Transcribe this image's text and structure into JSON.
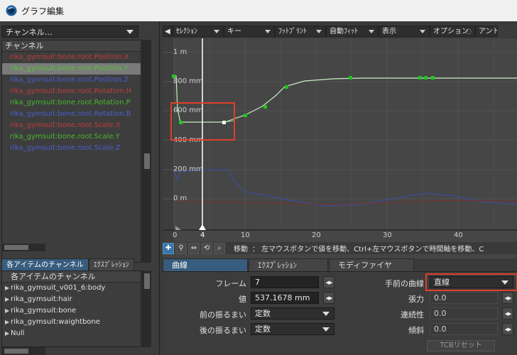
{
  "window": {
    "title": "グラフ編集"
  },
  "left": {
    "channel_dropdown": "チャンネル…",
    "channel_header": "チャンネル",
    "channels": [
      {
        "label": "rika_gymsuit:bone.root.Position.X",
        "color": "#c23b3b"
      },
      {
        "label": "rika_gymsuit:bone.root.Position.Y",
        "color": "#59c23b"
      },
      {
        "label": "rika_gymsuit:bone.root.Position.Z",
        "color": "#4a5fd0"
      },
      {
        "label": "rika_gymsuit:bone.root.Rotation.H",
        "color": "#c23b3b"
      },
      {
        "label": "rika_gymsuit:bone.root.Rotation.P",
        "color": "#45b82e"
      },
      {
        "label": "rika_gymsuit:bone.root.Rotation.B",
        "color": "#4a5fd0"
      },
      {
        "label": "rika_gymsuit:bone.root.Scale.X",
        "color": "#c23b3b"
      },
      {
        "label": "rika_gymsuit:bone.root.Scale.Y",
        "color": "#45b82e"
      },
      {
        "label": "rika_gymsuit:bone.root.Scale.Z",
        "color": "#4a5fd0"
      }
    ],
    "tabs": [
      "各アイテムのチャンネル",
      "ｴｸｽﾌﾟﾚｯｼｮﾝ"
    ],
    "item_header": "各アイテムのチャンネル",
    "items": [
      "rika_gymsuit_v001_6:body",
      "rika_gymsuit:hair",
      "rika_gymsuit:bone",
      "rika_gymsuit:waightbone",
      "Null"
    ]
  },
  "toolbar": {
    "selection": "ｾﾚｸｼｮﾝ",
    "key": "キー",
    "footprint": "ﾌｯﾄﾌﾟﾘﾝﾄ",
    "autofit": "自動ﾌｨｯﾄ",
    "display": "表示",
    "options": "オプション",
    "undo": "アンド"
  },
  "graph": {
    "y_labels": [
      "1 m",
      "800 mm",
      "600 mm",
      "400 mm",
      "200 mm",
      "0 m"
    ],
    "x_labels": [
      "0",
      "4",
      "10",
      "20",
      "30",
      "40"
    ],
    "current_frame": 4
  },
  "tools": {
    "mode_label": "移動",
    "hint": "： 左マウスボタンで値を移動、Ctrl+左マウスボタンで時間軸を移動、C"
  },
  "panel": {
    "tabs": [
      "曲線",
      "ｴｸｽﾌﾟﾚｯｼｮﾝ",
      "モディファイヤ"
    ],
    "frame_label": "フレーム",
    "frame_value": "7",
    "value_label": "値",
    "value_value": "537.1678 mm",
    "pre_behavior_label": "前の振るまい",
    "pre_behavior_value": "定数",
    "post_behavior_label": "後の振るまい",
    "post_behavior_value": "定数",
    "incoming_curve_label": "手前の曲線",
    "incoming_curve_value": "直線",
    "tension_label": "張力",
    "tension_value": "0.0",
    "continuity_label": "連続性",
    "continuity_value": "0.0",
    "bias_label": "傾斜",
    "bias_value": "0.0",
    "tcb_reset": "TCBリセット"
  }
}
